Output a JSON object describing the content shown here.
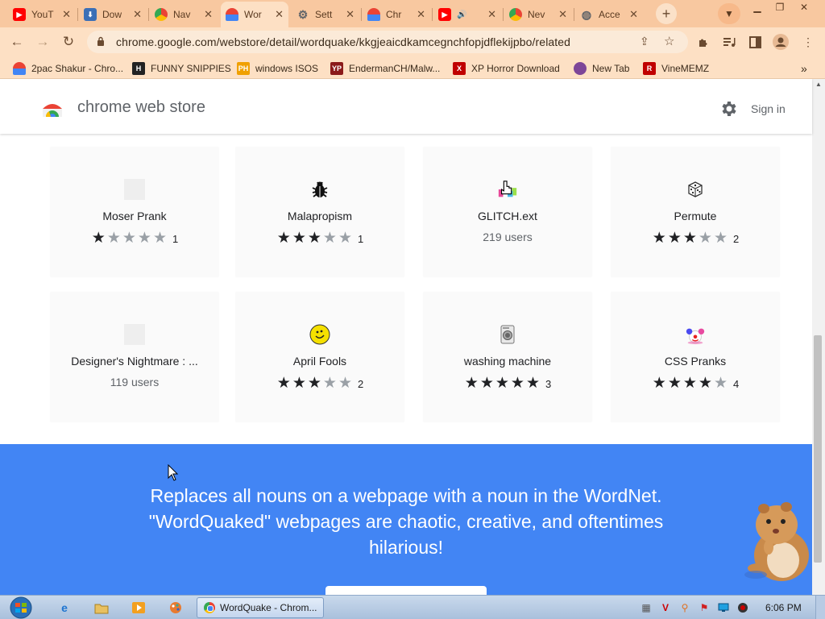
{
  "browser": {
    "tabs": [
      {
        "title": "YouT",
        "icon": "youtube-icon",
        "color": "#ff0000",
        "active": false
      },
      {
        "title": "Dow",
        "icon": "download-icon",
        "color": "#3b6fb6",
        "active": false
      },
      {
        "title": "Nav",
        "icon": "chrome-icon",
        "color": "#4285f4",
        "active": false
      },
      {
        "title": "Wor",
        "icon": "webstore-icon",
        "color": "#e34c26",
        "active": true
      },
      {
        "title": "Sett",
        "icon": "gear-icon",
        "color": "#5f6368",
        "active": false
      },
      {
        "title": "Chr",
        "icon": "webstore-icon",
        "color": "#e34c26",
        "active": false
      },
      {
        "title": "",
        "icon": "youtube-icon",
        "color": "#ff0000",
        "active": false
      },
      {
        "title": "Nev",
        "icon": "chrome-icon",
        "color": "#5f6368",
        "active": false
      },
      {
        "title": "Acce",
        "icon": "globe-icon",
        "color": "#5f6368",
        "active": false
      }
    ],
    "close_glyph": "✕",
    "new_tab_glyph": "+",
    "url": "chrome.google.com/webstore/detail/wordquake/kkgjeaicdkamcegnchfopjdflekijpbo/related",
    "bookmarks": [
      {
        "label": "2pac Shakur - Chro...",
        "icon": "webstore-icon",
        "color": "#e34c26",
        "glyph": ""
      },
      {
        "label": "FUNNY SNIPPIES",
        "icon": "h-icon",
        "color": "#222222",
        "glyph": "H"
      },
      {
        "label": "windows ISOS",
        "icon": "ph-icon",
        "color": "#f0a000",
        "glyph": "PH"
      },
      {
        "label": "EndermanCH/Malw...",
        "icon": "yp-icon",
        "color": "#8b1a1a",
        "glyph": "YP"
      },
      {
        "label": "XP Horror Download",
        "icon": "x-icon",
        "color": "#c00000",
        "glyph": "X"
      },
      {
        "label": "New Tab",
        "icon": "tor-icon",
        "color": "#7d4698",
        "glyph": ""
      },
      {
        "label": "VineMEMZ",
        "icon": "r-icon",
        "color": "#c00000",
        "glyph": "R"
      }
    ],
    "bookmarks_more": "»"
  },
  "store": {
    "title": "chrome web store",
    "signin": "Sign in"
  },
  "cards": [
    {
      "name": "Moser Prank",
      "icon": "blank-icon",
      "rating": 1,
      "count": "1",
      "users": ""
    },
    {
      "name": "Malapropism",
      "icon": "bug-icon",
      "rating": 3,
      "count": "1",
      "users": ""
    },
    {
      "name": "GLITCH.ext",
      "icon": "hand-cursor-icon",
      "rating": 0,
      "count": "",
      "users": "219 users"
    },
    {
      "name": "Permute",
      "icon": "dice-icon",
      "rating": 3,
      "count": "2",
      "users": ""
    },
    {
      "name": "Designer's Nightmare : ...",
      "icon": "blank-icon",
      "rating": 0,
      "count": "",
      "users": "119 users"
    },
    {
      "name": "April Fools",
      "icon": "smiley-icon",
      "rating": 3,
      "count": "2",
      "users": ""
    },
    {
      "name": "washing machine",
      "icon": "washing-machine-icon",
      "rating": 5,
      "count": "3",
      "users": ""
    },
    {
      "name": "CSS Pranks",
      "icon": "clown-icon",
      "rating": 4,
      "count": "4",
      "users": ""
    }
  ],
  "banner": {
    "description": "Replaces all nouns on a webpage with a noun in the WordNet. \"WordQuaked\" webpages are chaotic, creative, and oftentimes hilarious!",
    "color": "#4285f4"
  },
  "taskbar": {
    "active_window": "WordQuake - Chrom...",
    "clock": "6:06 PM"
  }
}
